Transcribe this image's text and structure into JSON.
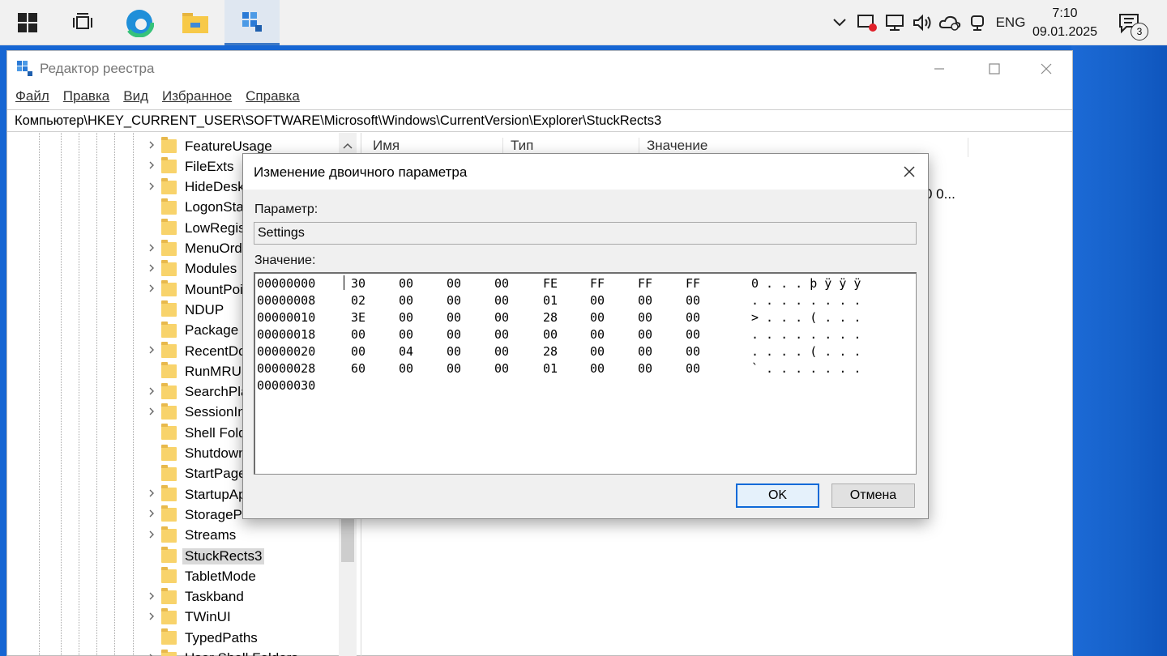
{
  "taskbar": {
    "apps": [
      {
        "name": "start",
        "icon": "windows-logo-icon"
      },
      {
        "name": "task-view",
        "icon": "task-view-icon"
      },
      {
        "name": "edge",
        "icon": "edge-icon"
      },
      {
        "name": "file-explorer",
        "icon": "folder-icon"
      },
      {
        "name": "regedit",
        "icon": "regedit-icon",
        "active": true
      }
    ],
    "tray": {
      "chevron": "^",
      "lang": "ENG",
      "time": "7:10",
      "date": "09.01.2025",
      "notifications_count": "3"
    }
  },
  "window": {
    "title": "Редактор реестра",
    "controls": {
      "minimize": "—",
      "maximize": "☐",
      "close": "✕"
    },
    "menu": [
      "Файл",
      "Правка",
      "Вид",
      "Избранное",
      "Справка"
    ],
    "address": "Компьютер\\HKEY_CURRENT_USER\\SOFTWARE\\Microsoft\\Windows\\CurrentVersion\\Explorer\\StuckRects3",
    "tree": [
      {
        "label": "FeatureUsage",
        "expandable": true
      },
      {
        "label": "FileExts",
        "expandable": true
      },
      {
        "label": "HideDeskt",
        "expandable": true
      },
      {
        "label": "LogonStat",
        "expandable": false
      },
      {
        "label": "LowRegist",
        "expandable": false
      },
      {
        "label": "MenuOrde",
        "expandable": true
      },
      {
        "label": "Modules",
        "expandable": true
      },
      {
        "label": "MountPoi",
        "expandable": true
      },
      {
        "label": "NDUP",
        "expandable": false
      },
      {
        "label": "Package Ir",
        "expandable": false
      },
      {
        "label": "RecentDoc",
        "expandable": true
      },
      {
        "label": "RunMRU",
        "expandable": false
      },
      {
        "label": "SearchPlat",
        "expandable": true
      },
      {
        "label": "SessionInf",
        "expandable": true
      },
      {
        "label": "Shell Folde",
        "expandable": false
      },
      {
        "label": "Shutdown",
        "expandable": false
      },
      {
        "label": "StartPage",
        "expandable": false
      },
      {
        "label": "StartupAp",
        "expandable": true
      },
      {
        "label": "StoragePro",
        "expandable": true
      },
      {
        "label": "Streams",
        "expandable": true
      },
      {
        "label": "StuckRects3",
        "expandable": false,
        "selected": true
      },
      {
        "label": "TabletMode",
        "expandable": false
      },
      {
        "label": "Taskband",
        "expandable": true
      },
      {
        "label": "TWinUI",
        "expandable": true
      },
      {
        "label": "TypedPaths",
        "expandable": false
      },
      {
        "label": "User Shell Folders",
        "expandable": true
      }
    ],
    "columns": [
      "Имя",
      "Тип",
      "Значение"
    ],
    "visible_value_fragment": "0 0..."
  },
  "dialog": {
    "title": "Изменение двоичного параметра",
    "close": "✕",
    "param_label": "Параметр:",
    "param_value": "Settings",
    "value_label": "Значение:",
    "hex_rows": [
      {
        "addr": "00000000",
        "bytes": [
          "30",
          "00",
          "00",
          "00",
          "FE",
          "FF",
          "FF",
          "FF"
        ],
        "ascii": "0 . . . þ ÿ ÿ ÿ"
      },
      {
        "addr": "00000008",
        "bytes": [
          "02",
          "00",
          "00",
          "00",
          "01",
          "00",
          "00",
          "00"
        ],
        "ascii": ". . . . . . . ."
      },
      {
        "addr": "00000010",
        "bytes": [
          "3E",
          "00",
          "00",
          "00",
          "28",
          "00",
          "00",
          "00"
        ],
        "ascii": "> . . . ( . . ."
      },
      {
        "addr": "00000018",
        "bytes": [
          "00",
          "00",
          "00",
          "00",
          "00",
          "00",
          "00",
          "00"
        ],
        "ascii": ". . . . . . . ."
      },
      {
        "addr": "00000020",
        "bytes": [
          "00",
          "04",
          "00",
          "00",
          "28",
          "00",
          "00",
          "00"
        ],
        "ascii": ". . . . ( . . ."
      },
      {
        "addr": "00000028",
        "bytes": [
          "60",
          "00",
          "00",
          "00",
          "01",
          "00",
          "00",
          "00"
        ],
        "ascii": "` . . . . . . ."
      },
      {
        "addr": "00000030",
        "bytes": [],
        "ascii": ""
      }
    ],
    "ok_label": "OK",
    "cancel_label": "Отмена"
  },
  "colors": {
    "desktop": "#1666d3",
    "taskbar": "#f1f1f1",
    "folder": "#f8d36b",
    "accent": "#0f6ad8"
  }
}
